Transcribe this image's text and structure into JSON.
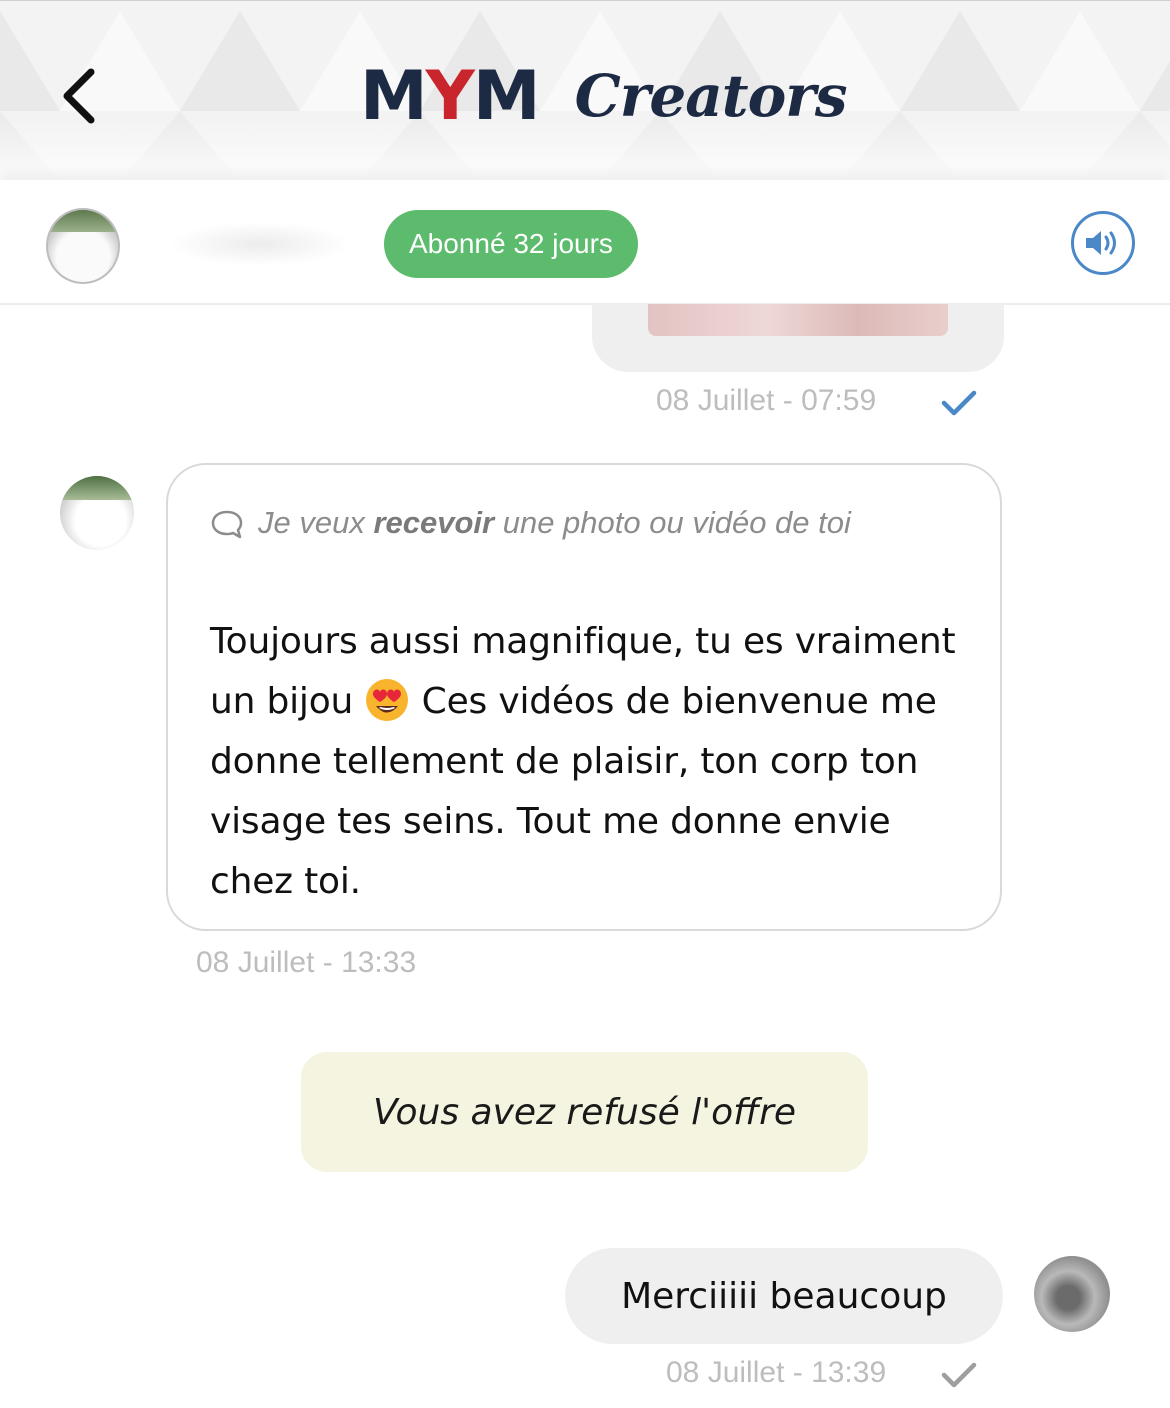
{
  "header": {
    "logo_part1": "M",
    "logo_part2": "Y",
    "logo_part3": "M",
    "logo_word": "Creators",
    "back_icon": "chevron-left-icon"
  },
  "subheader": {
    "subscription_badge": "Abonné 32 jours",
    "sound_icon": "speaker-icon",
    "badge_color": "#5cbb6c",
    "sound_color": "#4a88c7"
  },
  "messages": {
    "first_timestamp": "08 Juillet - 07:59",
    "fan_request_pre": "Je veux ",
    "fan_request_bold": "recevoir",
    "fan_request_post": " une photo ou vidéo de toi",
    "fan_text_part1": "Toujours aussi magnifique, tu es vraiment un bijou ",
    "fan_emoji": "heart-eyes-emoji",
    "fan_text_part2": " Ces vidéos de bienvenue me donne tellement de plaisir, ton corp ton visage tes seins. Tout me donne envie chez toi.",
    "fan_timestamp": "08 Juillet - 13:33",
    "offer_status": "Vous avez refusé l'offre",
    "reply_text": "Merciiiii beaucoup",
    "reply_timestamp": "08 Juillet - 13:39"
  }
}
